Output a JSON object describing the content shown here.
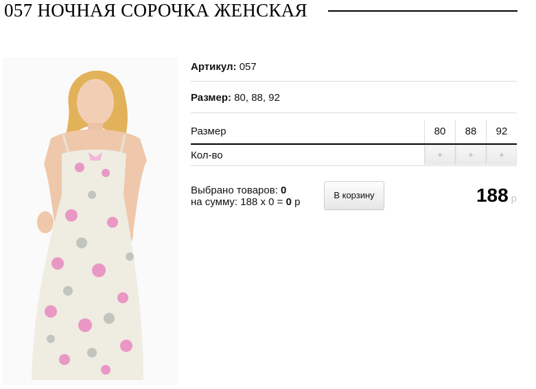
{
  "product": {
    "title": "057 НОЧНАЯ СОРОЧКА ЖЕНСКАЯ",
    "article_label": "Артикул:",
    "article_value": "057",
    "size_label": "Размер:",
    "size_value": "80, 88, 92"
  },
  "size_table": {
    "size_header": "Размер",
    "qty_label": "Кол-во",
    "sizes": [
      "80",
      "88",
      "92"
    ],
    "plus": "+"
  },
  "order": {
    "selected_label": "Выбрано товаров:",
    "selected_count": "0",
    "sum_label": "на сумму: 188 x 0 =",
    "sum_value": "0",
    "sum_currency": "р",
    "cart_button": "В корзину"
  },
  "price": {
    "value": "188",
    "currency": "р"
  }
}
